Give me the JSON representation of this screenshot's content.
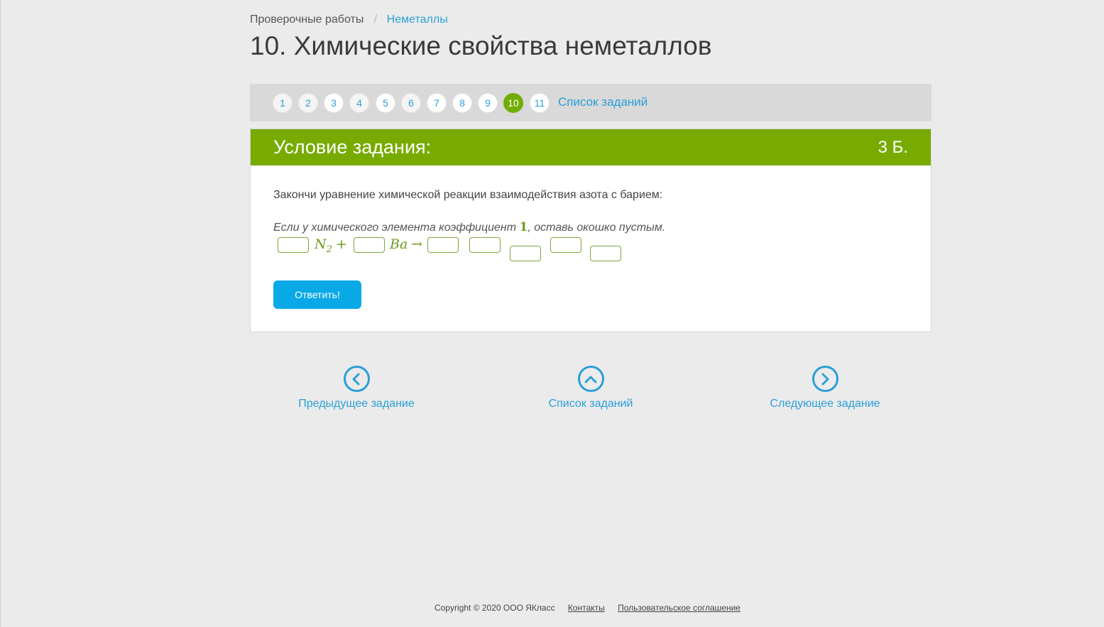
{
  "breadcrumb": {
    "parent": "Проверочные работы",
    "separator": "/",
    "current": "Неметаллы"
  },
  "page_title": "10. Химические свойства неметаллов",
  "task_nav": {
    "numbers": [
      "1",
      "2",
      "3",
      "4",
      "5",
      "6",
      "7",
      "8",
      "9",
      "10",
      "11"
    ],
    "active": "10",
    "list_link": "Список заданий"
  },
  "task": {
    "header_title": "Условие задания:",
    "points": "3 Б.",
    "text": "Закончи уравнение химической реакции взаимодействия азота с барием:",
    "hint_before": "Если у химического элемента коэффициент ",
    "hint_number": "1",
    "hint_after": ", оставь окошко пустым.",
    "equation": {
      "reactant1": "N",
      "reactant1_sub": "2",
      "plus": "+",
      "reactant2": "Ba",
      "arrow": "→"
    },
    "submit_label": "Ответить!"
  },
  "bottom_nav": {
    "prev": "Предыдущее задание",
    "list": "Список заданий",
    "next": "Следующее задание"
  },
  "footer": {
    "copyright": "Copyright © 2020 ООО ЯКласс",
    "contacts": "Контакты",
    "agreement": "Пользовательское соглашение"
  },
  "colors": {
    "accent_green": "#77ab00",
    "link_blue": "#2a9fd8",
    "button_blue": "#09a9e8"
  }
}
